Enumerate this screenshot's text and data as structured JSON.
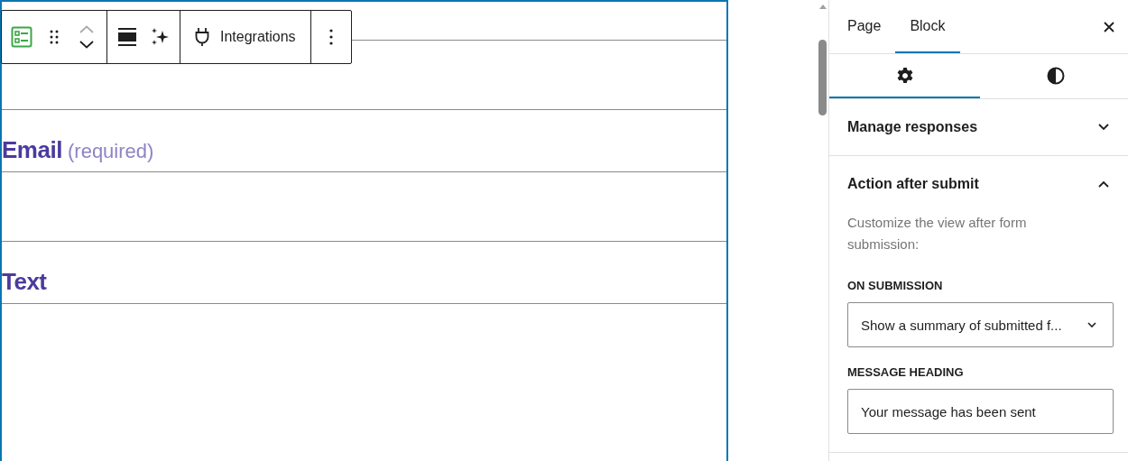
{
  "toolbar": {
    "groups": [
      {
        "items": [
          {
            "kind": "form-icon"
          },
          {
            "kind": "drag"
          },
          {
            "kind": "move"
          }
        ]
      },
      {
        "items": [
          {
            "kind": "align"
          },
          {
            "kind": "sparkle"
          }
        ]
      },
      {
        "items": [
          {
            "kind": "plug",
            "label": "Integrations"
          }
        ]
      },
      {
        "items": [
          {
            "kind": "more"
          }
        ]
      }
    ]
  },
  "form_fields": [
    {
      "kind": "input"
    },
    {
      "kind": "label",
      "text": "Email",
      "note": "(required)"
    },
    {
      "kind": "input"
    },
    {
      "kind": "label",
      "text": "Text"
    },
    {
      "kind": "input"
    }
  ],
  "sidebar": {
    "tabs": [
      {
        "label": "Page",
        "selected": false
      },
      {
        "label": "Block",
        "selected": true
      }
    ],
    "sub_tabs": [
      {
        "kind": "settings",
        "selected": true
      },
      {
        "kind": "styles",
        "selected": false
      }
    ],
    "panels": [
      {
        "title": "Manage responses",
        "expanded": false
      },
      {
        "title": "Action after submit",
        "expanded": true,
        "description": "Customize the view after form submission:",
        "controls": [
          {
            "kind": "select",
            "label": "ON SUBMISSION",
            "value": "Show a summary of submitted f..."
          },
          {
            "kind": "text",
            "label": "MESSAGE HEADING",
            "value": "Your message has been sent"
          }
        ]
      }
    ]
  }
}
